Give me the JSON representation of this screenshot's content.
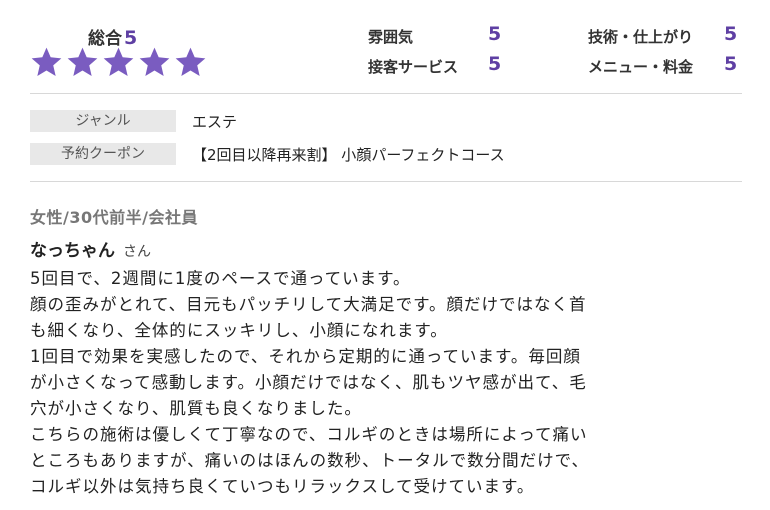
{
  "rating": {
    "overall_label": "総合",
    "overall_value": "5",
    "stars": 5,
    "categories": [
      {
        "label": "雰囲気",
        "value": "5"
      },
      {
        "label": "技術・仕上がり",
        "value": "5"
      },
      {
        "label": "接客サービス",
        "value": "5"
      },
      {
        "label": "メニュー・料金",
        "value": "5"
      }
    ]
  },
  "details": {
    "genre_label": "ジャンル",
    "genre_value": "エステ",
    "coupon_label": "予約クーポン",
    "coupon_value": "【2回目以降再来割】 小顔パーフェクトコース"
  },
  "reviewer": {
    "meta": "女性/30代前半/会社員",
    "name": "なっちゃん",
    "suffix": "さん"
  },
  "review": {
    "lines": [
      "5回目で、2週間に1度のペースで通っています。",
      "顔の歪みがとれて、目元もパッチリして大満足です。顔だけではなく首",
      "も細くなり、全体的にスッキリし、小顔になれます。",
      "1回目で効果を実感したので、それから定期的に通っています。毎回顔",
      "が小さくなって感動します。小顔だけではなく、肌もツヤ感が出て、毛",
      "穴が小さくなり、肌質も良くなりました。",
      "こちらの施術は優しくて丁寧なので、コルギのときは場所によって痛い",
      "ところもありますが、痛いのはほんの数秒、トータルで数分間だけで、",
      "コルギ以外は気持ち良くていつもリラックスして受けています。"
    ]
  },
  "colors": {
    "accent": "#5e3fa3",
    "star": "#7a5cc0"
  }
}
